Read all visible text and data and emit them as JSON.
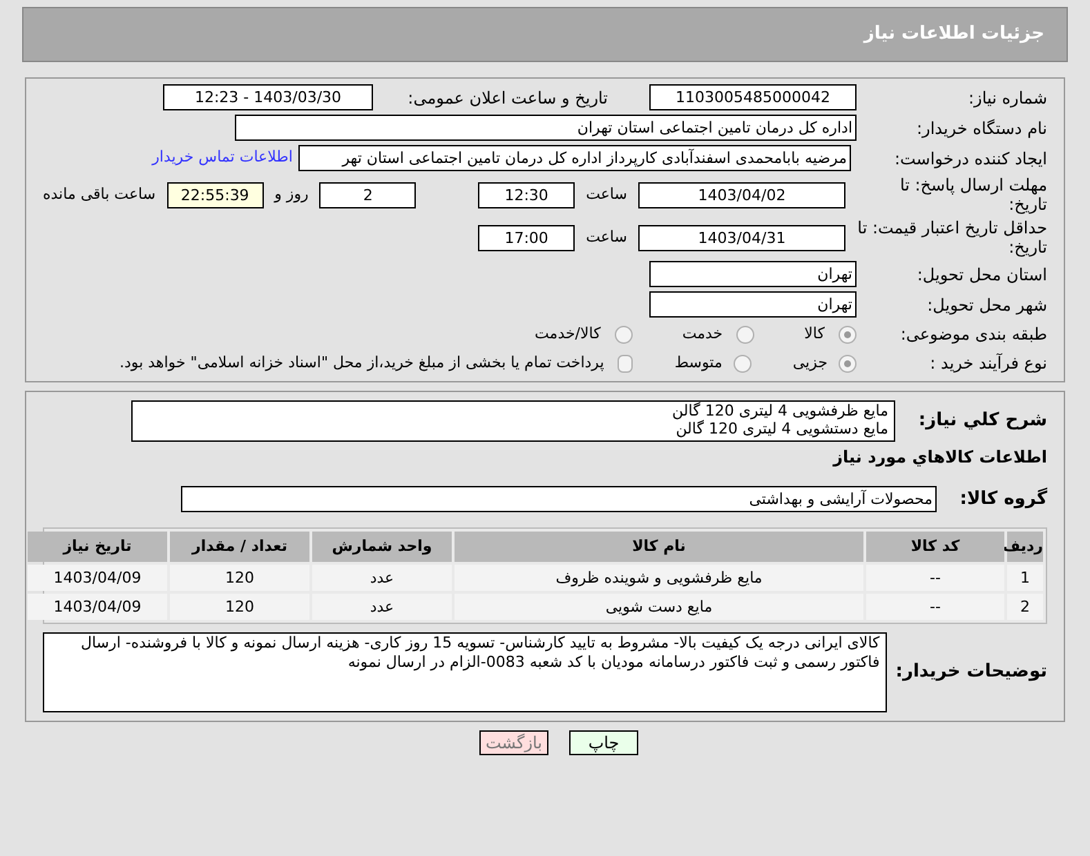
{
  "header": {
    "title": "جزئیات اطلاعات نیاز"
  },
  "need_number": {
    "label": "شماره نیاز:",
    "value": "1103005485000042"
  },
  "announce": {
    "label": "تاریخ و ساعت اعلان عمومی:",
    "value": "1403/03/30 - 12:23"
  },
  "buyer_org": {
    "label": "نام دستگاه خریدار:",
    "value": "اداره کل درمان تامین اجتماعی استان تهران"
  },
  "requester": {
    "label": "ایجاد کننده درخواست:",
    "value": "مرضیه بابامحمدی اسفندآبادی کارپرداز اداره کل درمان تامین اجتماعی استان تهر",
    "link": "اطلاعات تماس خریدار"
  },
  "deadline": {
    "label": "مهلت ارسال پاسخ: تا تاریخ:",
    "date": "1403/04/02",
    "time_label": "ساعت",
    "time": "12:30",
    "days": "2",
    "days_label": "روز و",
    "remaining": "22:55:39",
    "remaining_label": "ساعت باقی مانده"
  },
  "validity": {
    "label": "حداقل تاریخ اعتبار قیمت: تا تاریخ:",
    "date": "1403/04/31",
    "time_label": "ساعت",
    "time": "17:00"
  },
  "province": {
    "label": "استان محل تحویل:",
    "value": "تهران"
  },
  "city": {
    "label": "شهر محل تحویل:",
    "value": "تهران"
  },
  "category": {
    "label": "طبقه بندی موضوعی:",
    "options": [
      {
        "label": "کالا",
        "selected": true
      },
      {
        "label": "خدمت",
        "selected": false
      },
      {
        "label": "کالا/خدمت",
        "selected": false
      }
    ]
  },
  "process": {
    "label": "نوع فرآیند خرید :",
    "options": [
      {
        "label": "جزیی",
        "selected": true
      },
      {
        "label": "متوسط",
        "selected": false
      }
    ],
    "treasury": {
      "label": "پرداخت تمام یا بخشی از مبلغ خرید،از محل \"اسناد خزانه اسلامی\" خواهد بود.",
      "checked": false
    }
  },
  "summary": {
    "label": "شرح کلي نياز:",
    "lines": [
      "مایع ظرفشویی 4 لیتری 120 گالن",
      "مایع دستشویی 4 لیتری 120 گالن"
    ]
  },
  "goods_heading": "اطلاعات كالاهاي مورد نياز",
  "goods_group": {
    "label": "گروه کالا:",
    "value": "محصولات آرایشی و بهداشتی"
  },
  "table": {
    "columns": [
      "رديف",
      "كد كالا",
      "نام كالا",
      "واحد شمارش",
      "تعداد / مقدار",
      "تاريخ نياز"
    ],
    "rows": [
      [
        "1",
        "--",
        "مایع ظرفشویی و شوینده ظروف",
        "عدد",
        "120",
        "1403/04/09"
      ],
      [
        "2",
        "--",
        "مایع دست شویی",
        "عدد",
        "120",
        "1403/04/09"
      ]
    ]
  },
  "buyer_notes": {
    "label": "توضیحات خریدار:",
    "value": "کالای ایرانی درجه یک کیفیت بالا- مشروط به تایید کارشناس- تسویه 15 روز کاری- هزینه ارسال نمونه و کالا با فروشنده- ارسال فاکتور رسمی و ثبت فاکتور درسامانه مودیان با کد شعبه 0083-الزام در ارسال نمونه"
  },
  "buttons": [
    {
      "label": "چاپ",
      "kind": "print"
    },
    {
      "label": "بازگشت",
      "kind": "back"
    }
  ]
}
